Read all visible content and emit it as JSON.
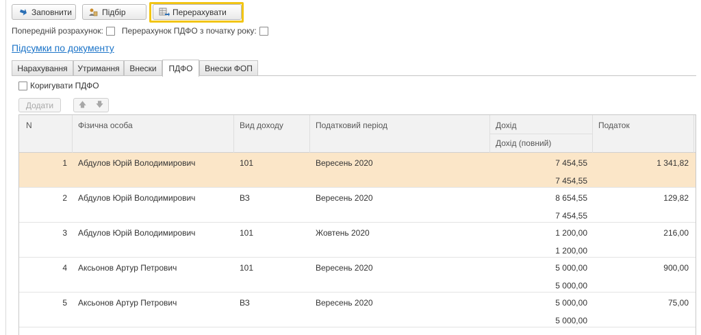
{
  "toolbar": {
    "fill_label": "Заповнити",
    "pick_label": "Підбір",
    "recalc_label": "Перерахувати"
  },
  "options": {
    "preliminary_label": "Попередній розрахунок:",
    "recalc_year_label": "Перерахунок ПДФО з початку року:"
  },
  "summary_link": "Підсумки по документу",
  "tabs": [
    {
      "label": "Нарахування"
    },
    {
      "label": "Утримання"
    },
    {
      "label": "Внески"
    },
    {
      "label": "ПДФО"
    },
    {
      "label": "Внески ФОП"
    }
  ],
  "correct_label": "Коригувати ПДФО",
  "add_label": "Додати",
  "table": {
    "headers": {
      "n": "N",
      "person": "Фізична особа",
      "income_type": "Вид доходу",
      "tax_period": "Податковий період",
      "income": "Дохід",
      "income_full": "Дохід (повний)",
      "tax": "Податок"
    },
    "rows": [
      {
        "n": "1",
        "person": "Абдулов Юрій Володимирович",
        "income_type": "101",
        "tax_period": "Вересень 2020",
        "income": "7 454,55",
        "income_full": "7 454,55",
        "tax": "1 341,82"
      },
      {
        "n": "2",
        "person": "Абдулов Юрій Володимирович",
        "income_type": "ВЗ",
        "tax_period": "Вересень 2020",
        "income": "8 654,55",
        "income_full": "7 454,55",
        "tax": "129,82"
      },
      {
        "n": "3",
        "person": "Абдулов Юрій Володимирович",
        "income_type": "101",
        "tax_period": "Жовтень 2020",
        "income": "1 200,00",
        "income_full": "1 200,00",
        "tax": "216,00"
      },
      {
        "n": "4",
        "person": "Аксьонов Артур Петрович",
        "income_type": "101",
        "tax_period": "Вересень 2020",
        "income": "5 000,00",
        "income_full": "5 000,00",
        "tax": "900,00"
      },
      {
        "n": "5",
        "person": "Аксьонов Артур Петрович",
        "income_type": "ВЗ",
        "tax_period": "Вересень 2020",
        "income": "5 000,00",
        "income_full": "5 000,00",
        "tax": "75,00"
      }
    ]
  },
  "colors": {
    "accent_frame": "#f2c514",
    "link": "#1a73c8",
    "selected_row": "#fbe6c8"
  }
}
